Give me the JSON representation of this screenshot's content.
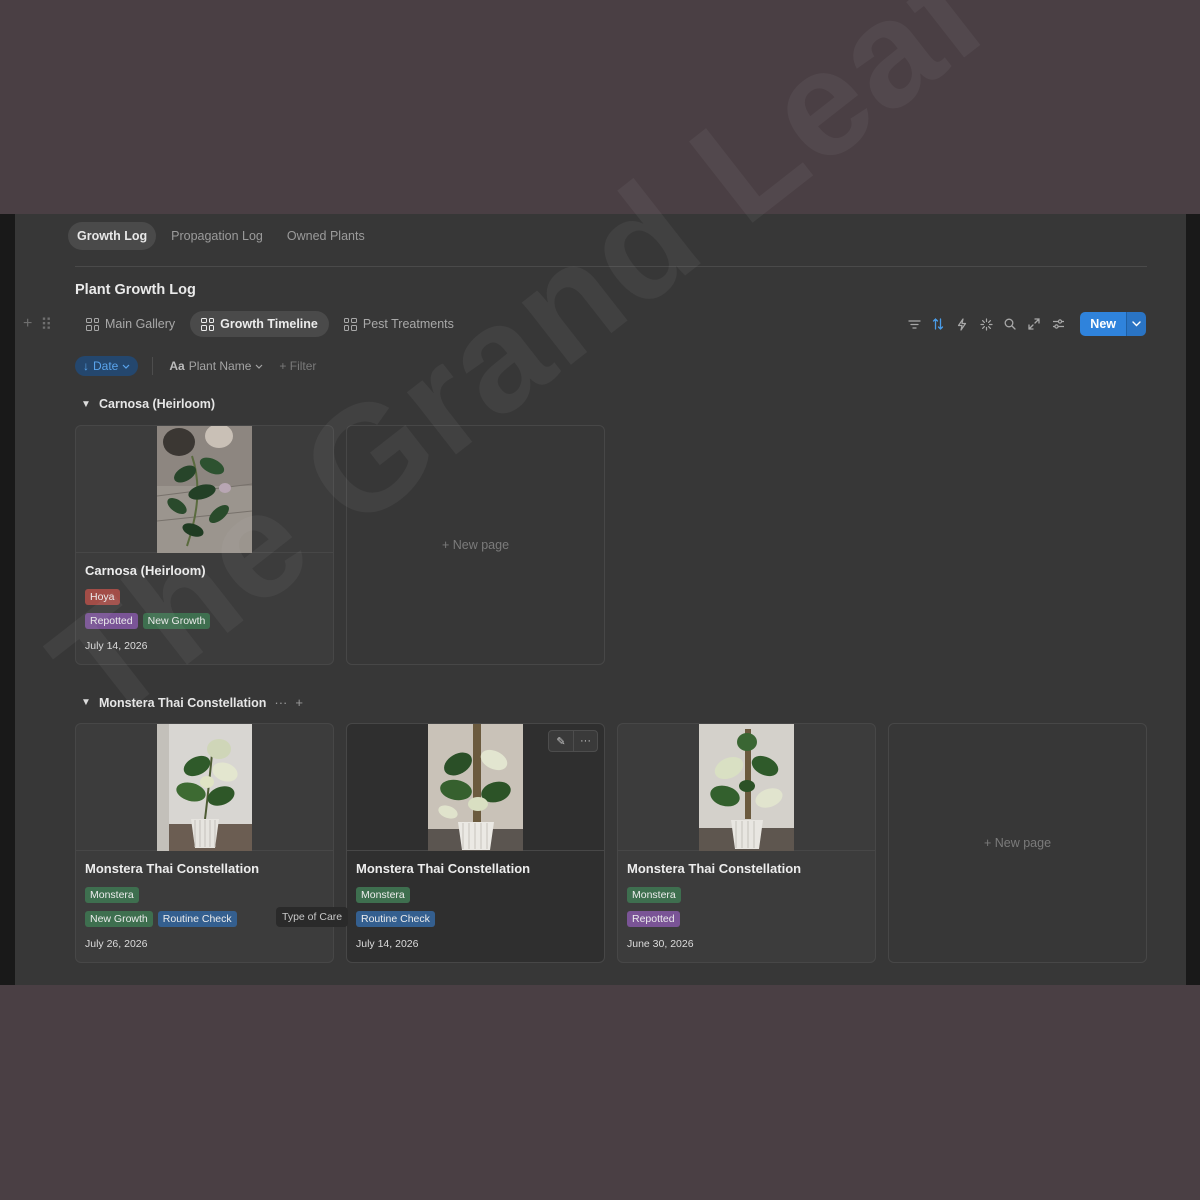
{
  "page_tabs": [
    {
      "label": "Growth Log",
      "active": true
    },
    {
      "label": "Propagation Log",
      "active": false
    },
    {
      "label": "Owned Plants",
      "active": false
    }
  ],
  "database": {
    "title": "Plant Growth Log"
  },
  "views": [
    {
      "label": "Main Gallery",
      "icon": "gallery-icon",
      "active": false
    },
    {
      "label": "Growth Timeline",
      "icon": "gallery-icon",
      "active": true
    },
    {
      "label": "Pest Treatments",
      "icon": "gallery-icon",
      "active": false
    }
  ],
  "toolbar": {
    "icons": [
      "filter-icon",
      "sort-icon",
      "automation-icon",
      "ai-sparkle-icon",
      "search-icon",
      "expand-icon",
      "settings-icon"
    ],
    "new_label": "New",
    "accent": "#2f83dc"
  },
  "filters": {
    "sort_label": "Date",
    "property_prefix": "Aa",
    "property_label": "Plant Name",
    "add_filter_label": "Filter"
  },
  "groups": [
    {
      "name": "Carnosa (Heirloom)",
      "cards": [
        {
          "title": "Carnosa (Heirloom)",
          "species": "Hoya",
          "care_tags": [
            "Repotted",
            "New Growth"
          ],
          "date": "July 14, 2026"
        }
      ],
      "new_page_label": "New page"
    },
    {
      "name": "Monstera Thai Constellation",
      "cards": [
        {
          "title": "Monstera Thai Constellation",
          "species": "Monstera",
          "care_tags": [
            "New Growth",
            "Routine Check"
          ],
          "date": "July 26, 2026"
        },
        {
          "title": "Monstera Thai Constellation",
          "species": "Monstera",
          "care_tags": [
            "Routine Check"
          ],
          "date": "July 14, 2026"
        },
        {
          "title": "Monstera Thai Constellation",
          "species": "Monstera",
          "care_tags": [
            "Repotted"
          ],
          "date": "June 30, 2026"
        }
      ],
      "new_page_label": "New page"
    }
  ],
  "tooltip": "Type of Care",
  "watermark": "The Grand Leaf",
  "tag_colors": {
    "Hoya": "#a24d47",
    "Repotted": "#7a5496",
    "New Growth": "#3e6f4f",
    "Monstera": "#3e6f4f",
    "Routine Check": "#345f8f"
  }
}
